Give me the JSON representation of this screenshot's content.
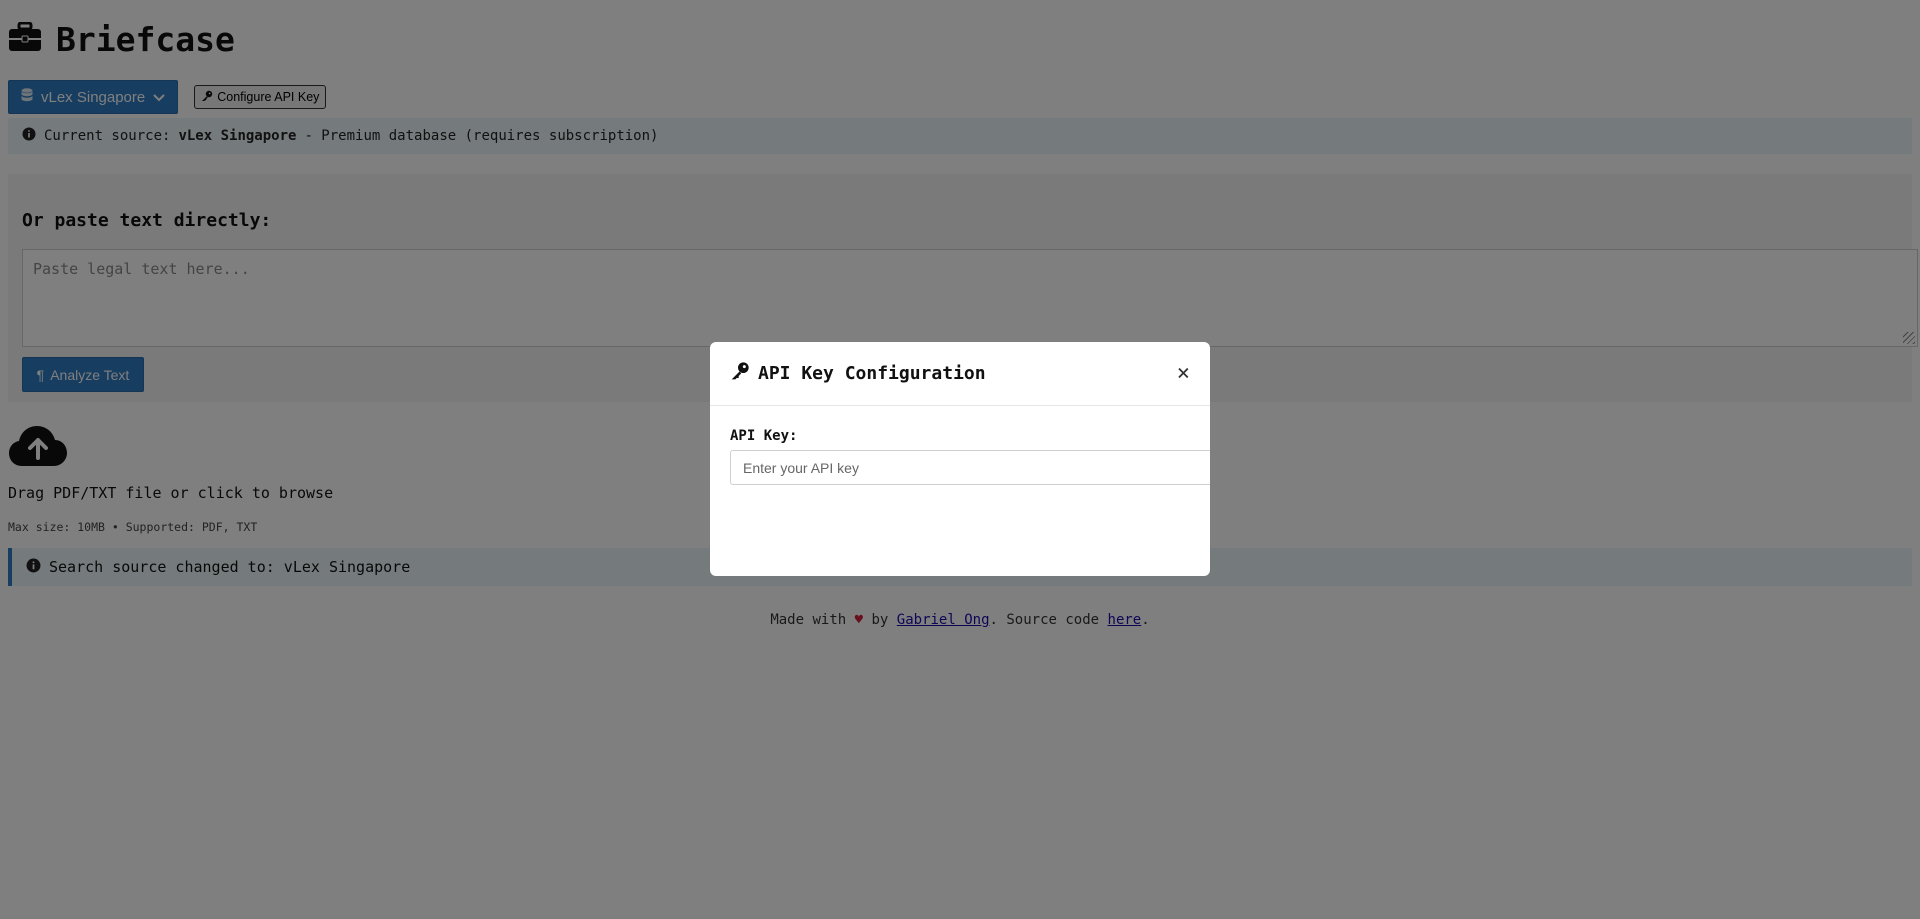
{
  "header": {
    "title": "Briefcase",
    "icon": "briefcase-icon"
  },
  "toolbar": {
    "source_label": "vLex Singapore",
    "config_label": "Configure API Key"
  },
  "info": {
    "prefix": "Current source:",
    "source": "vLex Singapore",
    "suffix": "- Premium database (requires subscription)"
  },
  "paste": {
    "heading": "Or paste text directly:",
    "placeholder": "Paste legal text here...",
    "analyze_label": "Analyze Text"
  },
  "upload": {
    "instruction": "Drag PDF/TXT file or click to browse",
    "limits": "Max size: 10MB • Supported: PDF, TXT"
  },
  "status": {
    "message": "Search source changed to: vLex Singapore"
  },
  "footer": {
    "made_with": "Made with",
    "heart": "♥",
    "by": "by",
    "author": "Gabriel Ong",
    "source_text": ". Source code",
    "here": "here",
    "end": "."
  },
  "modal": {
    "title": "API Key Configuration",
    "close": "×",
    "field_label": "API Key:",
    "input_placeholder": "Enter your API key"
  },
  "colors": {
    "primary": "#2f7ac0",
    "info_bg": "#eaf4f9",
    "overlay": "rgba(0,0,0,0.5)",
    "heart": "#d21f3c"
  }
}
